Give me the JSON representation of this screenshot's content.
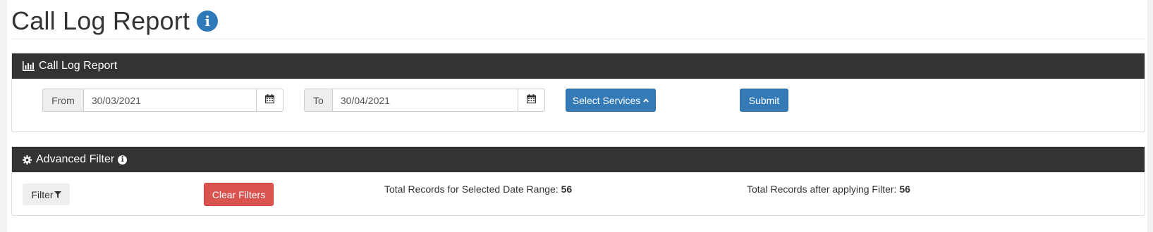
{
  "page": {
    "title": "Call Log Report",
    "title_icon": "info-circle-icon"
  },
  "report_panel": {
    "heading": "Call Log Report",
    "heading_icon": "bar-chart-icon",
    "from_label": "From",
    "from_value": "30/03/2021",
    "to_label": "To",
    "to_value": "30/04/2021",
    "calendar_icon": "calendar-icon",
    "select_services_label": "Select Services",
    "select_services_icon": "chevron-up-icon",
    "submit_label": "Submit"
  },
  "filter_panel": {
    "heading": "Advanced Filter",
    "heading_icon": "gear-icon",
    "heading_info_icon": "info-circle-icon",
    "filter_label": "Filter",
    "filter_icon": "funnel-icon",
    "clear_filters_label": "Clear Filters",
    "total_range_label": "Total Records for Selected Date Range:",
    "total_range_value": "56",
    "total_filter_label": "Total Records after applying Filter:",
    "total_filter_value": "56"
  },
  "colors": {
    "primary": "#337ab7",
    "danger": "#d9534f",
    "panel_header": "#333333",
    "info_icon": "#2f79b9"
  }
}
